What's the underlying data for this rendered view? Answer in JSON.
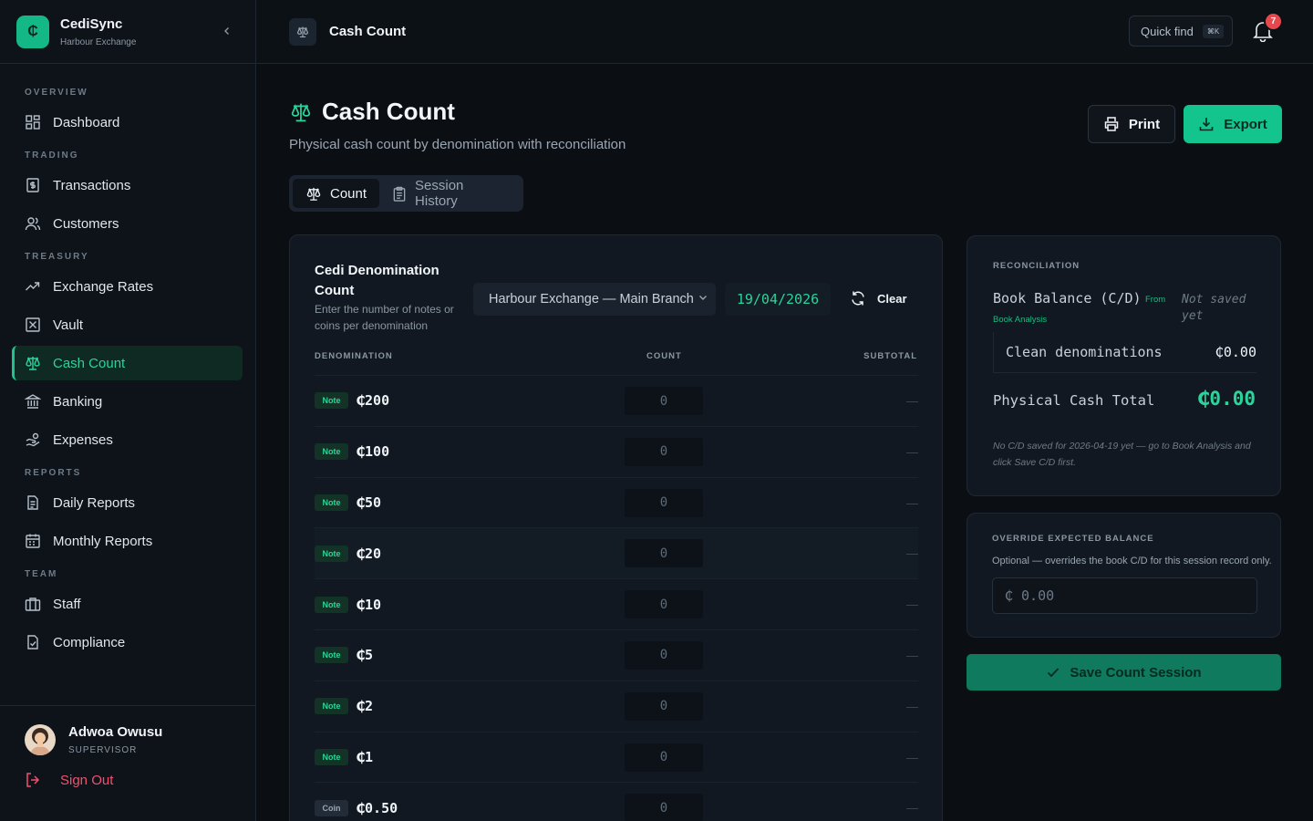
{
  "brand": {
    "logo_glyph": "₵",
    "name": "CediSync",
    "subtitle": "Harbour Exchange"
  },
  "sidebar": {
    "sections": {
      "overview": "OVERVIEW",
      "trading": "TRADING",
      "treasury": "TREASURY",
      "reports": "REPORTS",
      "team": "TEAM"
    },
    "items": {
      "dashboard": "Dashboard",
      "transactions": "Transactions",
      "customers": "Customers",
      "exchange_rates": "Exchange Rates",
      "vault": "Vault",
      "cash_count": "Cash Count",
      "banking": "Banking",
      "expenses": "Expenses",
      "daily_reports": "Daily Reports",
      "monthly_reports": "Monthly Reports",
      "staff": "Staff",
      "compliance": "Compliance"
    },
    "active": "cash_count",
    "user": {
      "name": "Adwoa Owusu",
      "role": "SUPERVISOR"
    },
    "signout": "Sign Out"
  },
  "topbar": {
    "title": "Cash Count",
    "quick_find": "Quick find",
    "shortcut": "⌘K",
    "notifications": "7"
  },
  "page": {
    "title": "Cash Count",
    "subtitle": "Physical cash count by denomination with reconciliation",
    "print": "Print",
    "export": "Export",
    "tabs": {
      "count": "Count",
      "history": "Session History"
    }
  },
  "count_card": {
    "title": "Cedi Denomination Count",
    "description": "Enter the number of notes or coins per denomination",
    "branch": "Harbour Exchange — Main Branch",
    "date": "19/04/2026",
    "clear": "Clear",
    "columns": {
      "denomination": "DENOMINATION",
      "count": "COUNT",
      "subtotal": "SUBTOTAL"
    },
    "rows": [
      {
        "type": "Note",
        "denom": "₵200",
        "count": "0",
        "subtotal": "—"
      },
      {
        "type": "Note",
        "denom": "₵100",
        "count": "0",
        "subtotal": "—"
      },
      {
        "type": "Note",
        "denom": "₵50",
        "count": "0",
        "subtotal": "—"
      },
      {
        "type": "Note",
        "denom": "₵20",
        "count": "0",
        "subtotal": "—"
      },
      {
        "type": "Note",
        "denom": "₵10",
        "count": "0",
        "subtotal": "—"
      },
      {
        "type": "Note",
        "denom": "₵5",
        "count": "0",
        "subtotal": "—"
      },
      {
        "type": "Note",
        "denom": "₵2",
        "count": "0",
        "subtotal": "—"
      },
      {
        "type": "Note",
        "denom": "₵1",
        "count": "0",
        "subtotal": "—"
      },
      {
        "type": "Coin",
        "denom": "₵0.50",
        "count": "0",
        "subtotal": "—"
      }
    ]
  },
  "reconciliation": {
    "label": "RECONCILIATION",
    "book_balance": "Book Balance (C/D)",
    "from": "From",
    "book_analysis": "Book Analysis",
    "not_saved": "Not saved yet",
    "clean_label": "Clean denominations",
    "clean_value": "₵0.00",
    "physical_label": "Physical Cash Total",
    "physical_value": "₵0.00",
    "note": "No C/D saved for 2026-04-19 yet — go to Book Analysis and click Save C/D first."
  },
  "override": {
    "label": "OVERRIDE EXPECTED BALANCE",
    "description": "Optional — overrides the book C/D for this session record only.",
    "currency": "₵",
    "placeholder": "0.00"
  },
  "save_button": "Save Count Session",
  "colors": {
    "accent": "#13c58d",
    "accent_text": "#2bd49a",
    "badge": "#e5484d",
    "signout": "#f0506e"
  }
}
